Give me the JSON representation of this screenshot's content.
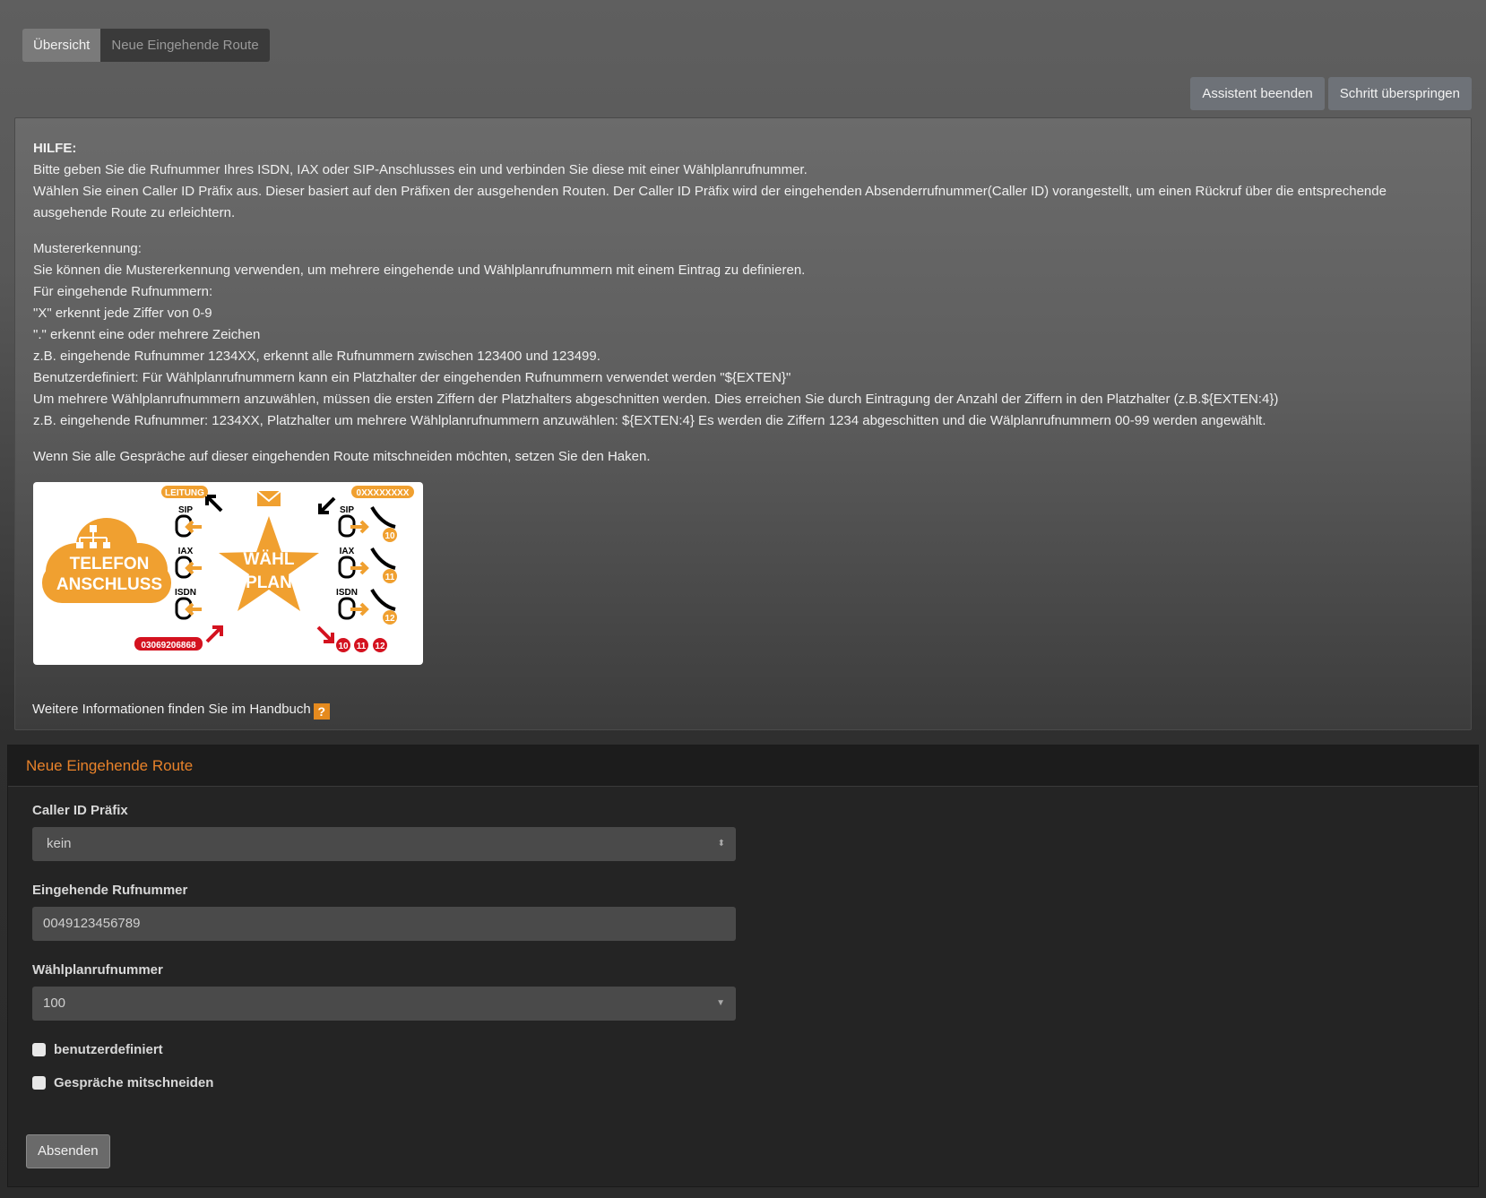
{
  "tabs": [
    {
      "label": "Übersicht",
      "active": true
    },
    {
      "label": "Neue Eingehende Route",
      "active": false
    }
  ],
  "wizard": {
    "finish_label": "Assistent beenden",
    "skip_label": "Schritt überspringen"
  },
  "help": {
    "title": "HILFE:",
    "intro": [
      "Bitte geben Sie die Rufnummer Ihres ISDN, IAX oder SIP-Anschlusses ein und verbinden Sie diese mit einer Wählplanrufnummer.",
      "Wählen Sie einen Caller ID Präfix aus. Dieser basiert auf den Präfixen der ausgehenden Routen. Der Caller ID Präfix wird der eingehenden Absenderrufnummer(Caller ID) vorangestellt, um einen Rückruf über die entsprechende ausgehende Route zu erleichtern."
    ],
    "pattern": [
      "Mustererkennung:",
      "Sie können die Mustererkennung verwenden, um mehrere eingehende und Wählplanrufnummern mit einem Eintrag zu definieren.",
      "Für eingehende Rufnummern:",
      "\"X\" erkennt jede Ziffer von 0-9",
      "\".\" erkennt eine oder mehrere Zeichen",
      "z.B. eingehende Rufnummer 1234XX, erkennt alle Rufnummern zwischen 123400 und 123499.",
      "Benutzerdefiniert: Für Wählplanrufnummern kann ein Platzhalter der eingehenden Rufnummern verwendet werden \"${EXTEN}\"",
      "Um mehrere Wählplanrufnummern anzuwählen, müssen die ersten Ziffern der Platzhalters abgeschnitten werden. Dies erreichen Sie durch Eintragung der Anzahl der Ziffern in den Platzhalter (z.B.${EXTEN:4})",
      "z.B. eingehende Rufnummer: 1234XX, Platzhalter um mehrere Wählplanrufnummern anzuwählen: ${EXTEN:4} Es werden die Ziffern 1234 abgeschitten und die Wälplanrufnummern 00-99 werden angewählt."
    ],
    "record_note": "Wenn Sie alle Gespräche auf dieser eingehenden Route mitschneiden möchten, setzen Sie den Haken.",
    "manual_text": "Weitere Informationen finden Sie im Handbuch",
    "manual_icon": "?",
    "diagram": {
      "cloud_line1": "TELEFON",
      "cloud_line2": "ANSCHLUSS",
      "leitung": "LEITUNG",
      "star_line1": "WÄHL",
      "star_line2": "PLAN",
      "pattern_badge": "0XXXXXXXX",
      "number_badge": "03069206868",
      "protocols": [
        "SIP",
        "IAX",
        "ISDN"
      ],
      "extensions": [
        "10",
        "11",
        "12"
      ],
      "orange": "#f0a030",
      "red": "#d4121f"
    }
  },
  "form": {
    "title": "Neue Eingehende Route",
    "caller_id_label": "Caller ID Präfix",
    "caller_id_value": "kein",
    "incoming_label": "Eingehende Rufnummer",
    "incoming_placeholder": "0049123456789",
    "dialplan_label": "Wählplanrufnummer",
    "dialplan_value": "100",
    "custom_label": "benutzerdefiniert",
    "record_label": "Gespräche mitschneiden",
    "submit_label": "Absenden"
  }
}
